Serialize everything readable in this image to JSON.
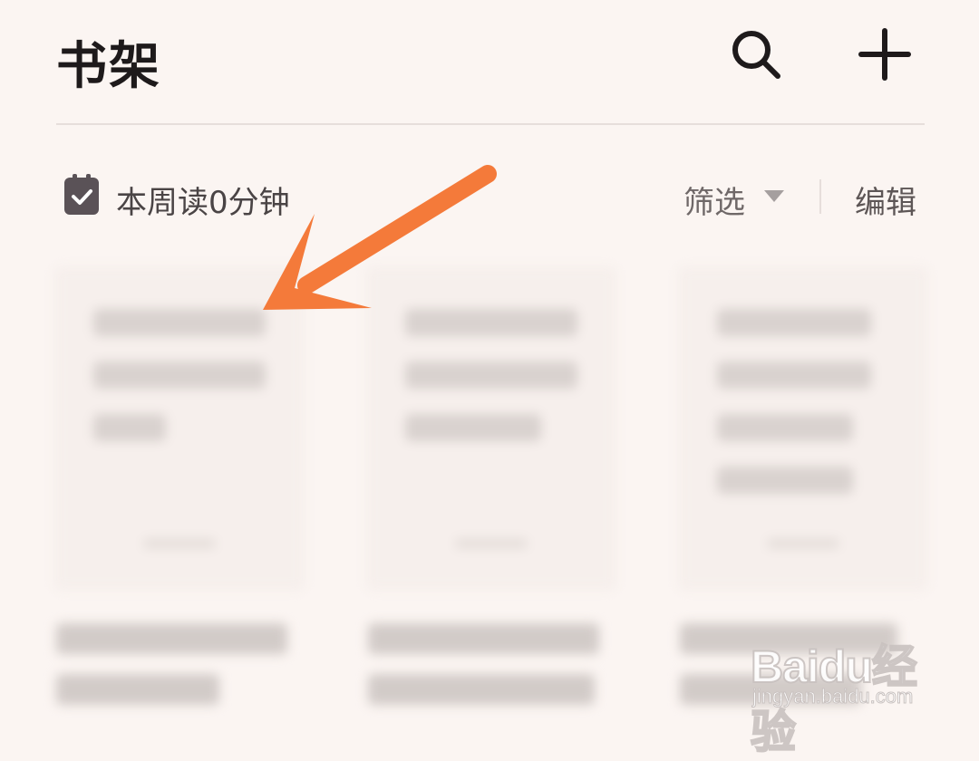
{
  "header": {
    "title": "书架",
    "search_icon": "search-icon",
    "add_icon": "plus-icon"
  },
  "stats": {
    "week_reading": "本周读0分钟",
    "icon": "calendar-check-icon"
  },
  "toolbar": {
    "filter_label": "筛选",
    "edit_label": "编辑"
  },
  "annotation": {
    "arrow_color": "#f47a3a"
  },
  "watermark": {
    "brand": "Baidu经验",
    "url": "jingyan.baidu.com"
  },
  "colors": {
    "background": "#fbf5f2",
    "title": "#1e1a1b",
    "muted": "#6f6868"
  }
}
